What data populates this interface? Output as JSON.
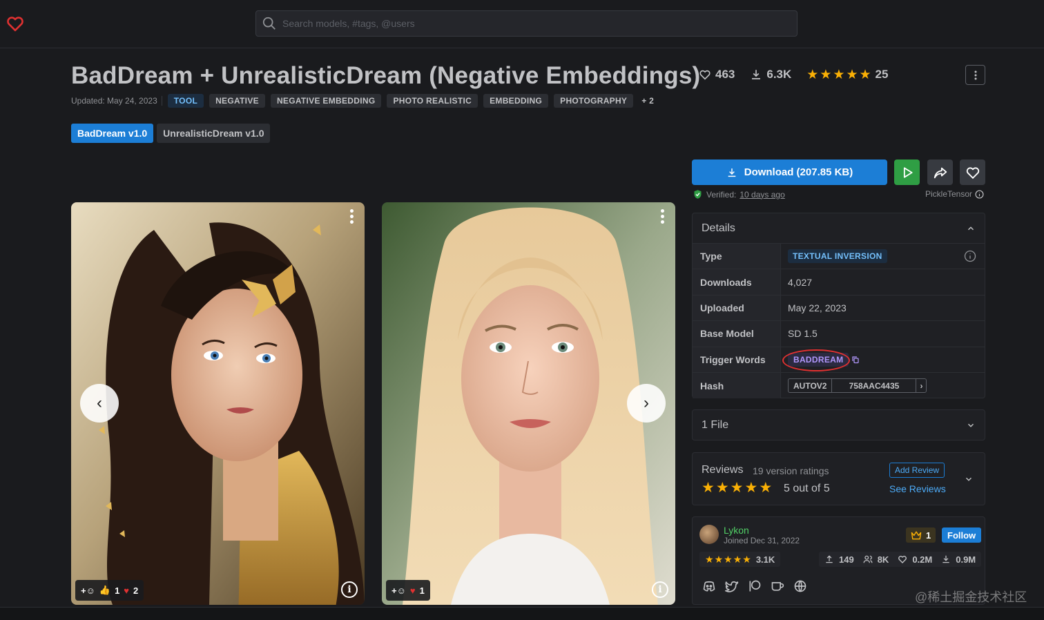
{
  "header": {
    "search_placeholder": "Search models, #tags, @users"
  },
  "model": {
    "title": "BadDream + UnrealisticDream (Negative Embeddings)",
    "likes": "463",
    "downloads": "6.3K",
    "rating_count": "25",
    "updated": "Updated: May 24, 2023",
    "tags": [
      "TOOL",
      "NEGATIVE",
      "NEGATIVE EMBEDDING",
      "PHOTO REALISTIC",
      "EMBEDDING",
      "PHOTOGRAPHY",
      "+ 2"
    ],
    "versions": [
      "BadDream v1.0",
      "UnrealisticDream v1.0"
    ]
  },
  "gallery": {
    "card1": {
      "thumbs": "1",
      "hearts": "2"
    },
    "card2": {
      "hearts": "1"
    }
  },
  "actions": {
    "download_label": "Download (207.85 KB)",
    "verified_label": "Verified:",
    "verified_time": "10 days ago",
    "scanner": "PickleTensor"
  },
  "details": {
    "title": "Details",
    "rows": [
      {
        "k": "Type",
        "v": "TEXTUAL INVERSION"
      },
      {
        "k": "Downloads",
        "v": "4,027"
      },
      {
        "k": "Uploaded",
        "v": "May 22, 2023"
      },
      {
        "k": "Base Model",
        "v": "SD 1.5"
      },
      {
        "k": "Trigger Words",
        "v": "BADDREAM"
      },
      {
        "k": "Hash",
        "v": "758AAC4435",
        "algo": "AUTOV2"
      }
    ]
  },
  "files": {
    "title": "1 File"
  },
  "reviews": {
    "title": "Reviews",
    "count": "19 version ratings",
    "score": "5 out of 5",
    "add_label": "Add Review",
    "see_label": "See Reviews"
  },
  "creator": {
    "name": "Lykon",
    "joined": "Joined Dec 31, 2022",
    "crown": "1",
    "follow_label": "Follow",
    "rating": "3.1K",
    "uploads": "149",
    "followers": "8K",
    "likes": "0.2M",
    "downloads": "0.9M"
  },
  "watermark": "@稀土掘金技术社区",
  "colors": {
    "accent": "#1c7ed6",
    "green": "#2f9e44",
    "star": "#fab005",
    "heart": "#e03131"
  }
}
